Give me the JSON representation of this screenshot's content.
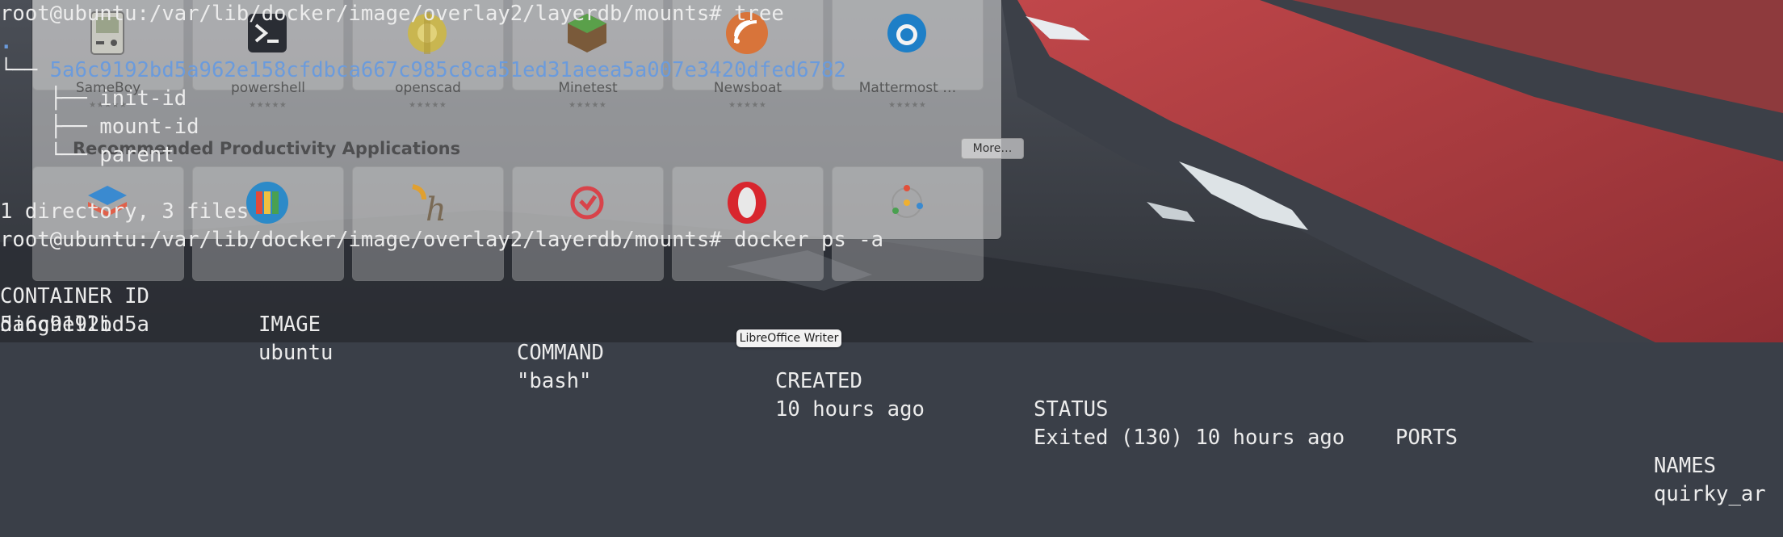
{
  "terminal": {
    "prompt1": "root@ubuntu:/var/lib/docker/image/overlay2/layerdb/mounts# tree",
    "tree_root": ".",
    "tree_dir_branch": "└── ",
    "tree_dir": "5a6c9192bd5a962e158cfdbca667c985c8ca51ed31aeea5a007e3420dfed6782",
    "tree_items": [
      {
        "branch": "    ├── ",
        "name": "init-id"
      },
      {
        "branch": "    ├── ",
        "name": "mount-id"
      },
      {
        "branch": "    └── ",
        "name": "parent"
      }
    ],
    "summary": "1 directory, 3 files",
    "prompt2": "root@ubuntu:/var/lib/docker/image/overlay2/layerdb/mounts# docker ps -a",
    "table": {
      "headers": [
        "CONTAINER ID",
        "IMAGE",
        "COMMAND",
        "CREATED",
        "STATUS",
        "PORTS",
        "NAMES"
      ],
      "row": [
        "5a6c9192bd5a",
        "ubuntu",
        "\"bash\"",
        "10 hours ago",
        "Exited (130) 10 hours ago",
        "",
        "quirky_ar"
      ],
      "wrap": "dinghelli"
    }
  },
  "software_center": {
    "apps": [
      {
        "name": "SameBoy",
        "stars": "★★★★★",
        "icon": "gameboy-icon"
      },
      {
        "name": "powershell",
        "stars": "★★★★★",
        "icon": "powershell-icon"
      },
      {
        "name": "openscad",
        "stars": "★★★★★",
        "icon": "openscad-icon"
      },
      {
        "name": "Minetest",
        "stars": "★★★★★",
        "icon": "minetest-icon"
      },
      {
        "name": "Newsboat",
        "stars": "★★★★★",
        "icon": "newsboat-icon"
      },
      {
        "name": "Mattermost …",
        "stars": "★★★★★",
        "icon": "mattermost-icon"
      }
    ],
    "section_title": "Recommended Productivity Applications",
    "more_label": "More…",
    "recommended_icons": [
      "layers-icon",
      "books-icon",
      "h-logo-icon",
      "todoist-icon",
      "opera-icon",
      "circle-dots-icon"
    ]
  },
  "taskbar": {
    "tooltip": "LibreOffice Writer"
  },
  "colors": {
    "terminal_text": "#ececec",
    "tree_dir_blue": "#6b9bdc",
    "mountain_red": "#b33a3a"
  }
}
